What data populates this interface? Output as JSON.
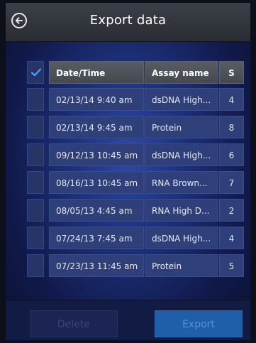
{
  "header": {
    "title": "Export data",
    "back_icon": "arrow-left-circle-icon"
  },
  "table": {
    "header": {
      "checked": true,
      "date": "Date/Time",
      "assay": "Assay name",
      "sample": "S"
    },
    "rows": [
      {
        "checked": false,
        "date": "02/13/14 9:40 am",
        "assay": "dsDNA High...",
        "sample": "4"
      },
      {
        "checked": false,
        "date": "02/13/14 9:45 am",
        "assay": "Protein",
        "sample": "8"
      },
      {
        "checked": false,
        "date": "09/12/13 10:45 am",
        "assay": "dsDNA High...",
        "sample": "6"
      },
      {
        "checked": false,
        "date": "08/16/13 10:45 am",
        "assay": "RNA Brown...",
        "sample": "7"
      },
      {
        "checked": false,
        "date": "08/05/13 4:45 am",
        "assay": "RNA High D...",
        "sample": "2"
      },
      {
        "checked": false,
        "date": "07/24/13 7:45 am",
        "assay": "dsDNA High...",
        "sample": "4"
      },
      {
        "checked": false,
        "date": "07/23/13 11:45 am",
        "assay": "Protein",
        "sample": "5"
      }
    ]
  },
  "footer": {
    "delete_label": "Delete",
    "export_label": "Export"
  },
  "colors": {
    "accent": "#1f5ea8",
    "check": "#4aa3ff",
    "background": "#1c2f78"
  }
}
